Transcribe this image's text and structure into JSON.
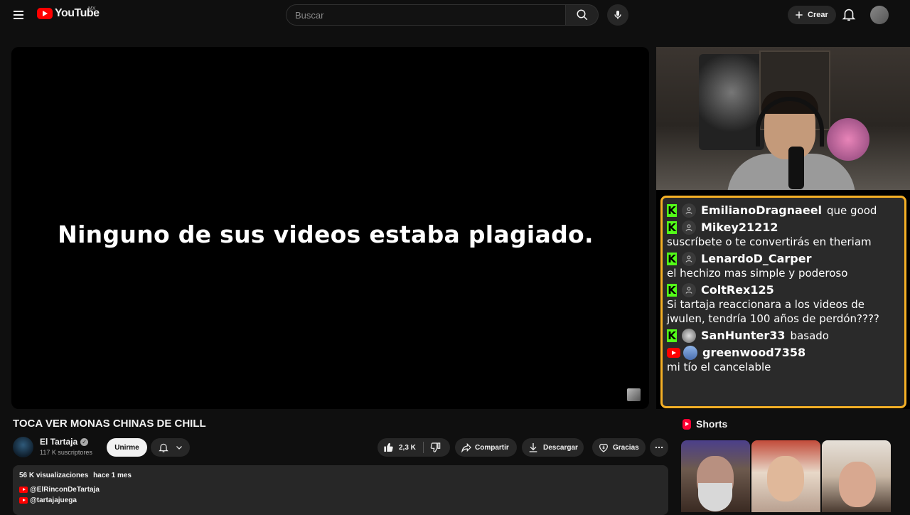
{
  "header": {
    "logo_text": "YouTube",
    "logo_country": "MX",
    "search_placeholder": "Buscar",
    "create_label": "Crear"
  },
  "player": {
    "caption": "Ninguno de sus videos estaba plagiado."
  },
  "chat": {
    "messages": [
      {
        "platform": "kick",
        "user": "EmilianoDragnaeel",
        "text": "que good",
        "text2": ""
      },
      {
        "platform": "kick",
        "user": "Mikey21212",
        "text": "",
        "text2": "suscríbete o te convertirás en theriam"
      },
      {
        "platform": "kick",
        "user": "LenardoD_Carper",
        "text": "",
        "text2": "el hechizo mas simple y poderoso"
      },
      {
        "platform": "kick",
        "user": "ColtRex125",
        "text": "",
        "text2": "Si tartaja reaccionara a los videos de jwulen, tendría 100 años de perdón????"
      },
      {
        "platform": "kick",
        "user": "SanHunter33",
        "text": "basado",
        "text2": ""
      },
      {
        "platform": "youtube",
        "user": "greenwood7358",
        "text": "mi tío el cancelable",
        "text2": ""
      }
    ]
  },
  "video": {
    "title": "TOCA VER MONAS CHINAS DE CHILL",
    "channel_name": "El Tartaja",
    "subscribers": "117 K suscriptores",
    "join_label": "Unirme",
    "likes": "2,3 K",
    "share_label": "Compartir",
    "download_label": "Descargar",
    "thanks_label": "Gracias"
  },
  "description": {
    "views": "56 K visualizaciones",
    "date": "hace 1 mes",
    "links": [
      "@ElRinconDeTartaja",
      "@tartajajuega"
    ]
  },
  "shorts": {
    "heading": "Shorts"
  },
  "colors": {
    "accent_red": "#ff0000",
    "kick_green": "#53fc18",
    "chat_border": "#f5b026"
  }
}
